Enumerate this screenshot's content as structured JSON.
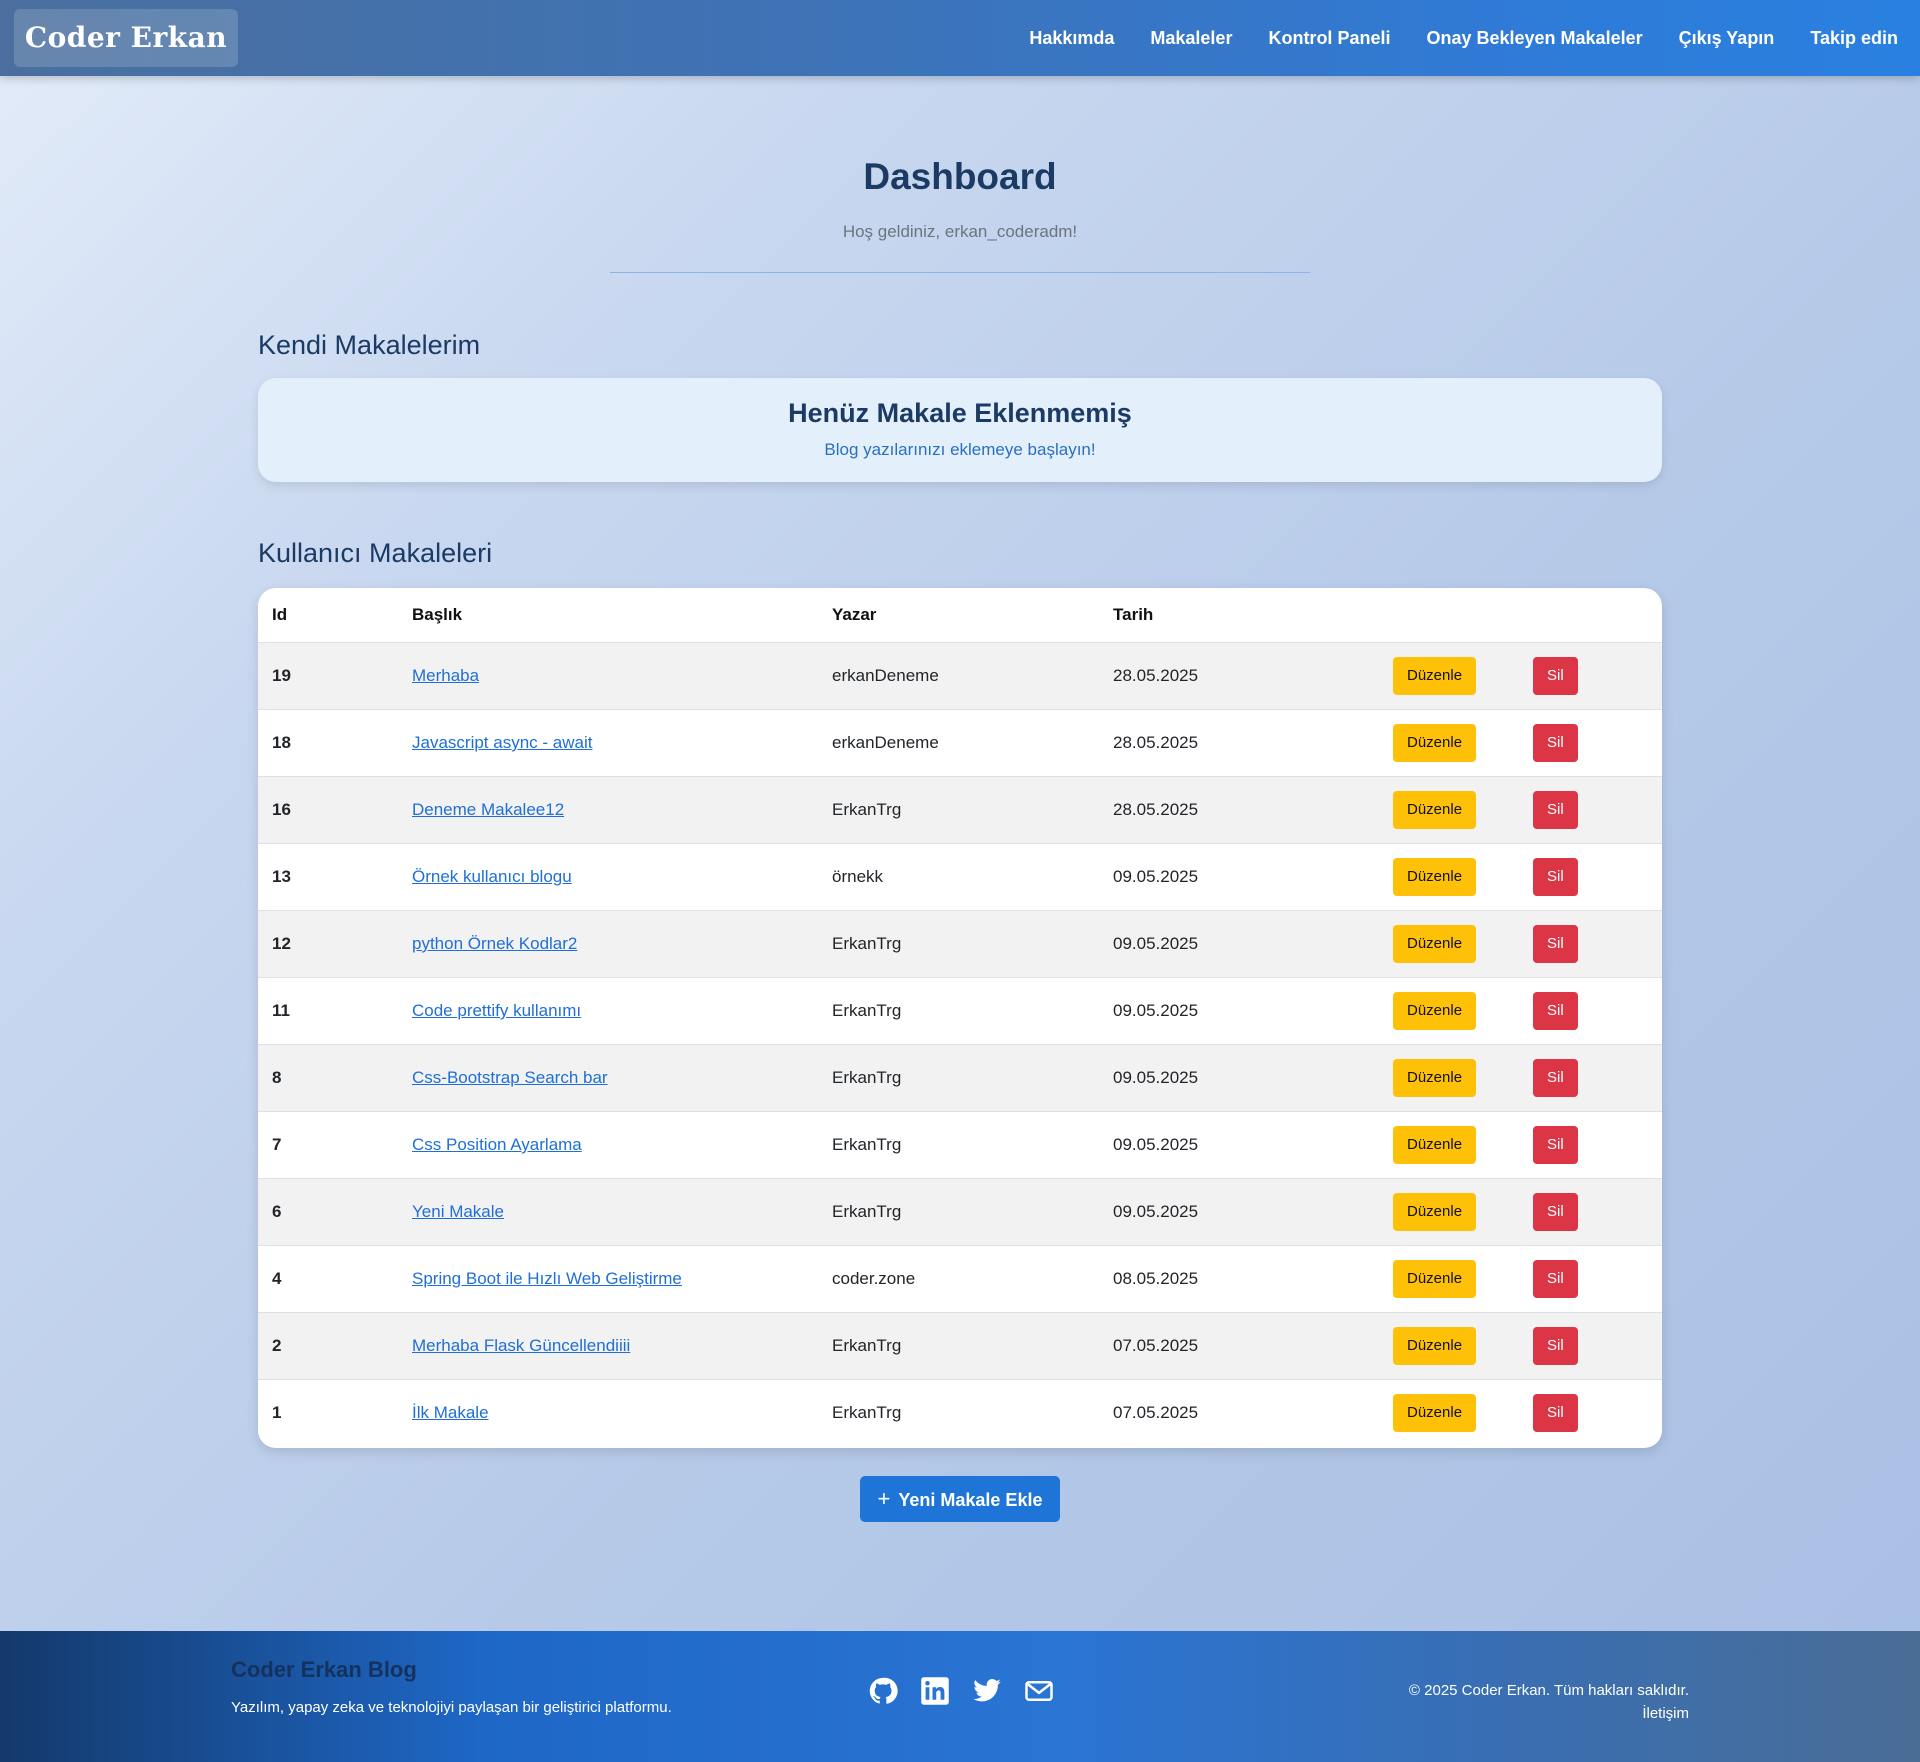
{
  "navbar": {
    "brand": "Coder Erkan",
    "links": [
      "Hakkımda",
      "Makaleler",
      "Kontrol Paneli",
      "Onay Bekleyen Makaleler",
      "Çıkış Yapın",
      "Takip edin"
    ]
  },
  "header": {
    "title": "Dashboard",
    "welcome": "Hoş geldiniz, erkan_coderadm!"
  },
  "own_articles": {
    "heading": "Kendi Makalelerim",
    "empty_title": "Henüz Makale Eklenmemiş",
    "empty_sub": "Blog yazılarınızı eklemeye başlayın!"
  },
  "user_articles": {
    "heading": "Kullanıcı Makaleleri",
    "columns": [
      "Id",
      "Başlık",
      "Yazar",
      "Tarih"
    ],
    "edit_label": "Düzenle",
    "delete_label": "Sil",
    "rows": [
      {
        "id": "19",
        "title": "Merhaba",
        "author": "erkanDeneme",
        "date": "28.05.2025"
      },
      {
        "id": "18",
        "title": "Javascript async - await",
        "author": "erkanDeneme",
        "date": "28.05.2025"
      },
      {
        "id": "16",
        "title": "Deneme Makalee12",
        "author": "ErkanTrg",
        "date": "28.05.2025"
      },
      {
        "id": "13",
        "title": "Örnek kullanıcı blogu",
        "author": "örnekk",
        "date": "09.05.2025"
      },
      {
        "id": "12",
        "title": "python Örnek Kodlar2",
        "author": "ErkanTrg",
        "date": "09.05.2025"
      },
      {
        "id": "11",
        "title": "Code prettify kullanımı",
        "author": "ErkanTrg",
        "date": "09.05.2025"
      },
      {
        "id": "8",
        "title": "Css-Bootstrap Search bar",
        "author": "ErkanTrg",
        "date": "09.05.2025"
      },
      {
        "id": "7",
        "title": "Css Position Ayarlama",
        "author": "ErkanTrg",
        "date": "09.05.2025"
      },
      {
        "id": "6",
        "title": "Yeni Makale",
        "author": "ErkanTrg",
        "date": "09.05.2025"
      },
      {
        "id": "4",
        "title": "Spring Boot ile Hızlı Web Geliştirme",
        "author": "coder.zone",
        "date": "08.05.2025"
      },
      {
        "id": "2",
        "title": "Merhaba Flask Güncellendiiii",
        "author": "ErkanTrg",
        "date": "07.05.2025"
      },
      {
        "id": "1",
        "title": "İlk Makale",
        "author": "ErkanTrg",
        "date": "07.05.2025"
      }
    ]
  },
  "new_article_button": {
    "icon": "plus-icon",
    "label": "Yeni Makale Ekle"
  },
  "footer": {
    "title": "Coder Erkan Blog",
    "subtitle": "Yazılım, yapay zeka ve teknolojiyi paylaşan bir geliştirici platformu.",
    "icons": [
      "github-icon",
      "linkedin-icon",
      "twitter-icon",
      "email-icon"
    ],
    "copyright": "© 2025 Coder Erkan. Tüm hakları saklıdır.",
    "contact": "İletişim"
  },
  "colors": {
    "edit_button": "#ffc107",
    "delete_button": "#dc3545",
    "primary": "#1f74d8",
    "heading": "#1b3a64"
  }
}
